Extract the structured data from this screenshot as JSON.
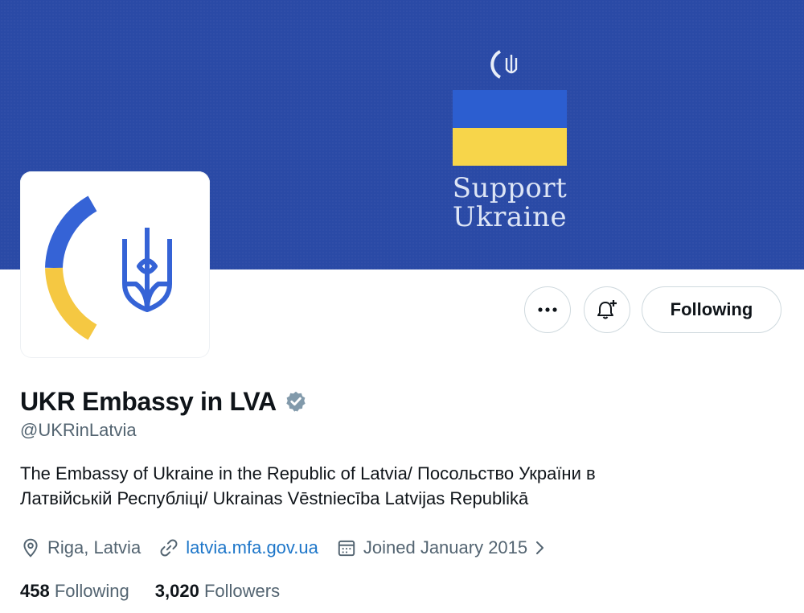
{
  "banner": {
    "line1": "Support",
    "line2": "Ukraine",
    "flag_colors": [
      "#2c5ed0",
      "#f7d54a"
    ],
    "background": "#2a4aa6"
  },
  "avatar": {
    "icon": "ukraine-trident-logo"
  },
  "actions": {
    "more_icon": "ellipsis-icon",
    "notify_icon": "bell-plus-icon",
    "follow_label": "Following"
  },
  "profile": {
    "display_name": "UKR Embassy in LVA",
    "verified_icon": "verified-badge-icon",
    "handle": "@UKRinLatvia",
    "bio_line1": "The Embassy of Ukraine in the Republic of Latvia/ Посольство України в",
    "bio_line2": "Латвійській Республіці/ Ukrainas Vēstniecība Latvijas Republikā",
    "location": "Riga, Latvia",
    "website": "latvia.mfa.gov.ua",
    "joined": "Joined January 2015"
  },
  "stats": {
    "following_count": "458",
    "following_label": "Following",
    "followers_count": "3,020",
    "followers_label": "Followers"
  }
}
